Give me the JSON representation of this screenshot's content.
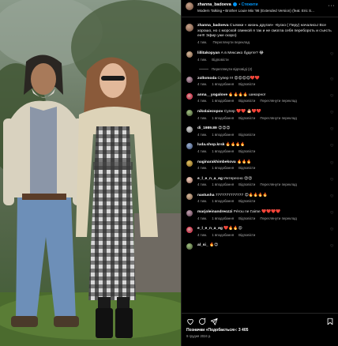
{
  "post": {
    "username": "zhanna_badoeva",
    "follow_label": "Стежити",
    "music": "Modern Talking • Brother Louie Mix '98 (Extended Version) (feat. Eric S...",
    "more_label": "···"
  },
  "caption": {
    "username": "zhanna_badoeva",
    "text": "Съемки « жизнь другая» -Куско ( Перу) начались! Все хорошо, но с морской свинкой я так и не смогла себя перебороть и съесть ее!!! Эфир уже скоро)",
    "time": "4 тиж.",
    "translate": "Переглянути переклад"
  },
  "comments": [
    {
      "username": "lillitakopyan",
      "text": "А в Мексико будете?",
      "emoji": "😂",
      "time": "4 тиж.",
      "likes": "",
      "reply": "Відповісти",
      "translate": "",
      "replies": "Переглянути відповіді (2)"
    },
    {
      "username": "zollomoda",
      "text": "Супер !!!",
      "emoji": "😍😍😍😍❤️❤️",
      "time": "4 тиж.",
      "likes": "1 вподобання",
      "reply": "Відповісти",
      "translate": "",
      "replies": ""
    },
    {
      "username": "anna__yogalove",
      "text": "",
      "emoji": "🔥🔥🔥🔥 шикарно!",
      "time": "4 тиж.",
      "likes": "1 вподобання",
      "reply": "Відповісти",
      "translate": "Переглянути переклад",
      "replies": ""
    },
    {
      "username": "nikolaiezopov",
      "text": "Супер",
      "emoji": "❤️❤️ 🎂❤️❤️",
      "time": "4 тиж.",
      "likes": "1 вподобання",
      "reply": "Відповісти",
      "translate": "Переглянути переклад",
      "replies": ""
    },
    {
      "username": "di_1989.89",
      "text": "",
      "emoji": "😍😍😍",
      "time": "4 тиж.",
      "likes": "1 вподобання",
      "reply": "Відповісти",
      "translate": "",
      "replies": ""
    },
    {
      "username": "luda.shop.krsk",
      "text": "",
      "emoji": "🔥🔥🔥🔥",
      "time": "4 тиж.",
      "likes": "1 вподобання",
      "reply": "Відповісти",
      "translate": "",
      "replies": ""
    },
    {
      "username": "naginarakhimbekova",
      "text": "",
      "emoji": "🔥🔥🔥",
      "time": "4 тиж.",
      "likes": "1 вподобання",
      "reply": "Відповісти",
      "translate": "",
      "replies": ""
    },
    {
      "username": "e_l_e_n_a_eg",
      "text": "Интересно",
      "emoji": "😍😍",
      "time": "4 тиж.",
      "likes": "1 вподобання",
      "reply": "Відповісти",
      "translate": "Переглянути переклад",
      "replies": ""
    },
    {
      "username": "nastusha",
      "text": "7777777777777",
      "emoji": "😍🔥🔥🔥🔥",
      "time": "4 тиж.",
      "likes": "1 вподобання",
      "reply": "Відповісти",
      "translate": "",
      "replies": ""
    },
    {
      "username": "marjoleinandreozzi",
      "text": "Pérou ne t'aime",
      "emoji": "❤️❤️❤️❤️",
      "time": "4 тиж.",
      "likes": "1 вподобання",
      "reply": "Відповісти",
      "translate": "Переглянути переклад",
      "replies": ""
    },
    {
      "username": "e_l_e_n_a_eg",
      "text": "",
      "emoji": "❤️🔥🔥😍",
      "time": "4 тиж.",
      "likes": "1 вподобання",
      "reply": "Відповісти",
      "translate": "",
      "replies": ""
    },
    {
      "username": "al_si_",
      "text": "",
      "emoji": "🔥😍",
      "time": "",
      "likes": "",
      "reply": "",
      "translate": "",
      "replies": ""
    }
  ],
  "footer": {
    "likes_label": "Позначки «Подобається»: 3 405",
    "date": "9 грудня 2024 р."
  },
  "icons": [
    "like-icon",
    "comment-icon",
    "share-icon",
    "save-icon"
  ]
}
